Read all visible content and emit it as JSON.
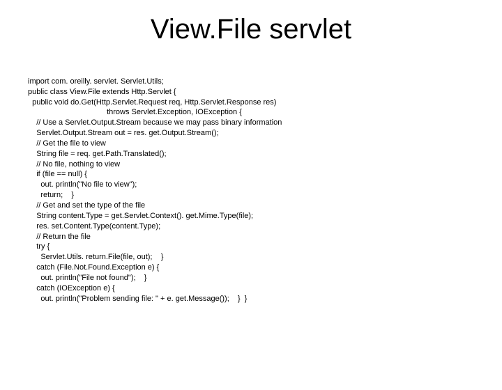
{
  "title": "View.File servlet",
  "code": {
    "l1": "import com. oreilly. servlet. Servlet.Utils;",
    "l2": "public class View.File extends Http.Servlet {",
    "l3": "  public void do.Get(Http.Servlet.Request req, Http.Servlet.Response res)",
    "l4": "                                     throws Servlet.Exception, IOException {",
    "l5": "    // Use a Servlet.Output.Stream because we may pass binary information",
    "l6": "    Servlet.Output.Stream out = res. get.Output.Stream();",
    "l7": "    // Get the file to view",
    "l8": "    String file = req. get.Path.Translated();",
    "l9": "    // No file, nothing to view",
    "l10": "    if (file == null) {",
    "l11": "      out. println(\"No file to view\");",
    "l12": "      return;    }",
    "l13": "    // Get and set the type of the file",
    "l14": "    String content.Type = get.Servlet.Context(). get.Mime.Type(file);",
    "l15": "    res. set.Content.Type(content.Type);",
    "l16": "    // Return the file",
    "l17": "    try {",
    "l18": "      Servlet.Utils. return.File(file, out);    }",
    "l19": "    catch (File.Not.Found.Exception e) {",
    "l20": "      out. println(\"File not found\");    }",
    "l21": "    catch (IOException e) {",
    "l22": "      out. println(\"Problem sending file: \" + e. get.Message());    }  }"
  }
}
